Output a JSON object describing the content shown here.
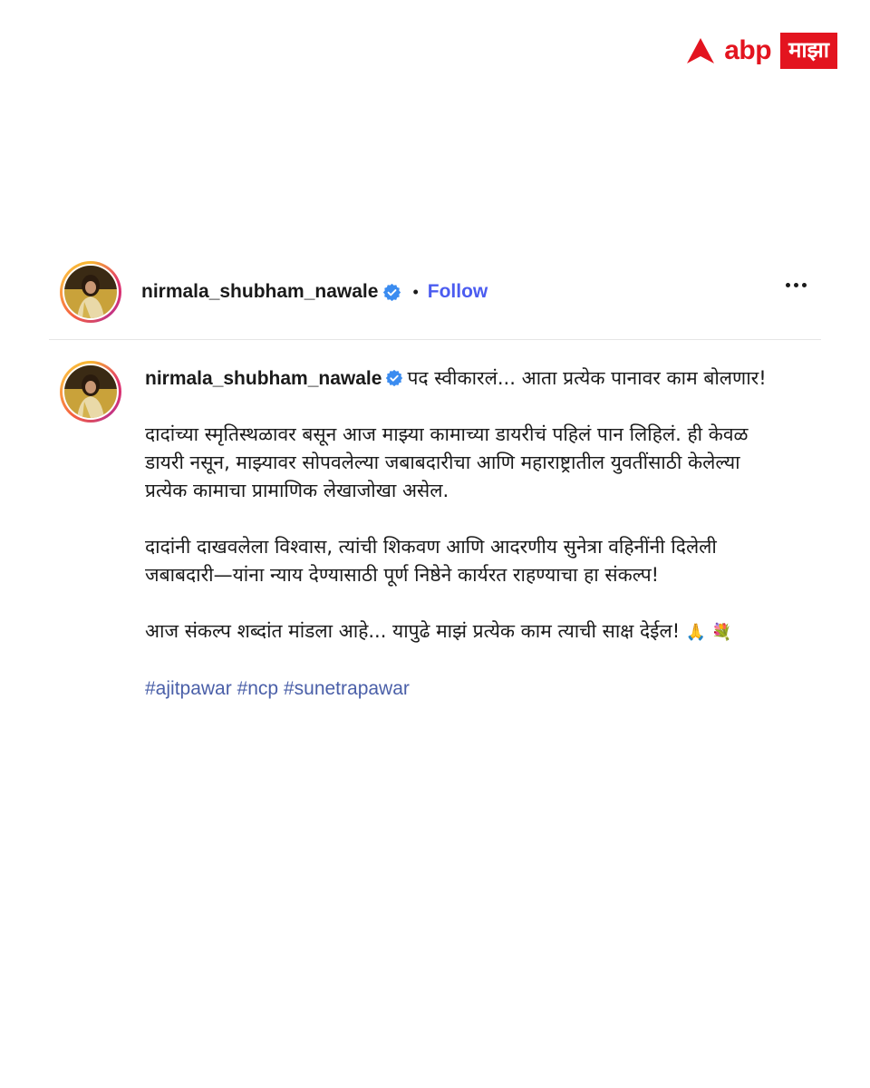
{
  "brand": {
    "word": "abp",
    "box_text": "माझा",
    "color": "#e3141f"
  },
  "post": {
    "username": "nirmala_shubham_nawale",
    "separator": "•",
    "follow_label": "Follow",
    "more_icon": "more-horizontal-icon",
    "verified_icon": "verified-badge-icon",
    "follow_color": "#4b5cf0"
  },
  "caption": {
    "username": "nirmala_shubham_nawale",
    "first_line": "पद स्वीकारलं... आता प्रत्येक पानावर काम बोलणार!",
    "para2": "दादांच्या स्मृतिस्थळावर बसून आज माझ्या कामाच्या डायरीचं पहिलं पान लिहिलं. ही केवळ डायरी नसून, माझ्यावर सोपवलेल्या जबाबदारीचा आणि महाराष्ट्रातील युवतींसाठी केलेल्या प्रत्येक कामाचा प्रामाणिक लेखाजोखा असेल.",
    "para3": "दादांनी दाखवलेला विश्वास, त्यांची शिकवण आणि आदरणीय सुनेत्रा वहिनींनी दिलेली जबाबदारी—यांना न्याय देण्यासाठी पूर्ण निष्ठेने कार्यरत राहण्याचा हा संकल्प!",
    "para4": "आज संकल्प शब्दांत मांडला आहे... यापुढे माझं प्रत्येक काम त्याची साक्ष देईल!",
    "emojis": "🙏 💐",
    "hashtags": [
      "#ajitpawar",
      "#ncp",
      "#sunetrapawar"
    ],
    "hashtag_color": "#4a5fa8"
  }
}
